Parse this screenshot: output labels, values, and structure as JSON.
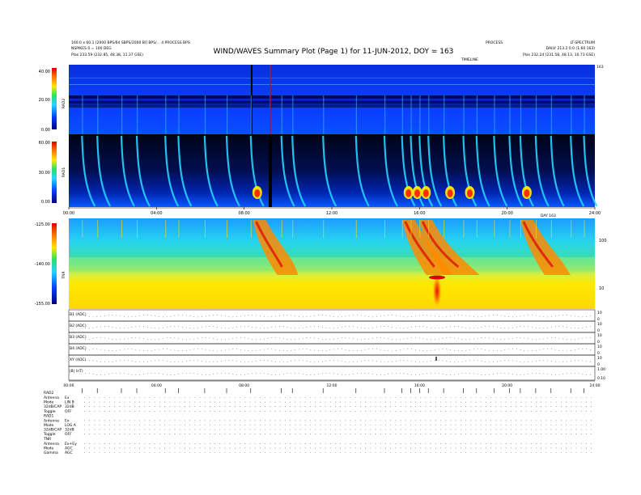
{
  "header": {
    "title": "WIND/WAVES Summary Plot (Page 1) for 11-JUN-2012, DOY = 163",
    "left_line1": "160.0 x 60.1 [2000 BPS/64 SBPS/2000 BI] BPS/... 4 PROCESS BPS",
    "left_line2": "NSPIKES 0 = 100 DEG",
    "left_line3": "Plas  233.59 (232.85, 48.38, 11.37 GSE)",
    "mid_line": "PROCESS",
    "right_line1": "LT-SPECTRUM",
    "right_line2": "DAILY  213.2 0.0 (1.60 163)",
    "right_line3": "Plas  232.24 (231.58, 48.13, 10.73 GSE)",
    "top_label_1": "TIMELINE",
    "top_label_2": "163"
  },
  "panels": {
    "rad2": {
      "label": "RAD2",
      "ticks": [
        "40.00",
        "20.00",
        "0.00"
      ]
    },
    "rad1": {
      "label": "RAD1",
      "ticks": [
        "60.00",
        "30.00",
        "0.00"
      ]
    },
    "tnr": {
      "label": "TNR",
      "ticks": [
        "-125.00",
        "-140.00",
        "-155.00"
      ],
      "right_ticks": [
        "100",
        "10"
      ]
    }
  },
  "time_axis": {
    "top_labels": [
      "00:00",
      "04:00",
      "08:00",
      "12:00",
      "16:00",
      "20:00",
      "24:00"
    ],
    "mid_label": "DAY 163",
    "bottom_labels": [
      "00:00",
      "04:00",
      "08:00",
      "12:00",
      "16:00",
      "20:00",
      "24:00"
    ]
  },
  "strip_labels": [
    "B1 (ADC)",
    "B2 (ADC)",
    "B3 (ADC)",
    "B4 (ADC)",
    "XY (ADC)",
    "|B| (nT)"
  ],
  "strip_right_ticks": [
    [
      "10",
      "0"
    ],
    [
      "10",
      "0"
    ],
    [
      "10",
      "0"
    ],
    [
      "10",
      "0"
    ],
    [
      "10",
      "0"
    ],
    [
      "1.00",
      "0.10"
    ]
  ],
  "settings": [
    {
      "group": "RAD2",
      "rows": [
        {
          "k": "Antenna",
          "v": "Ex"
        },
        {
          "k": "Mode",
          "v": "LIN B"
        },
        {
          "k": "32dB/CAP",
          "v": "32dB"
        },
        {
          "k": "Toggle",
          "v": "OFF"
        }
      ]
    },
    {
      "group": "RAD1",
      "rows": [
        {
          "k": "Antenna",
          "v": "Ex"
        },
        {
          "k": "Mode",
          "v": "LOG A"
        },
        {
          "k": "32dB/CAP",
          "v": "32dB"
        },
        {
          "k": "Toggle",
          "v": "OFF"
        }
      ]
    },
    {
      "group": "TNR",
      "rows": [
        {
          "k": "Antenna",
          "v": "Ex+Ey"
        },
        {
          "k": "Mode",
          "v": "AGC"
        },
        {
          "k": "Gamma",
          "v": "AGC"
        }
      ]
    }
  ],
  "colors": {
    "deep_blue": "#0000a8",
    "blue": "#0a3cff",
    "cyan": "#21d8ff",
    "green": "#28e06a",
    "yellow": "#ffe800",
    "orange": "#ff7800",
    "red": "#e00000",
    "black": "#000000"
  },
  "chart_data": {
    "type": "heatmap",
    "title": "WIND/WAVES Summary Plot (Page 1) for 11-JUN-2012, DOY = 163",
    "x_range_hours": [
      0,
      24
    ],
    "panels": [
      {
        "name": "RAD2",
        "y_range": [
          0,
          40
        ]
      },
      {
        "name": "RAD1",
        "y_range": [
          0,
          60
        ]
      },
      {
        "name": "TNR",
        "y_range": [
          -155,
          -125
        ]
      }
    ],
    "type_iii_bursts_hours": [
      0.6,
      1.3,
      2.4,
      3.1,
      4.4,
      5.0,
      6.2,
      7.2,
      8.3,
      9.7,
      10.2,
      11.6,
      13.1,
      14.4,
      15.2,
      15.6,
      16.0,
      16.4,
      17.1,
      18.0,
      18.6,
      19.4,
      20.1,
      20.6,
      21.3,
      22.0,
      22.9,
      23.5
    ]
  }
}
